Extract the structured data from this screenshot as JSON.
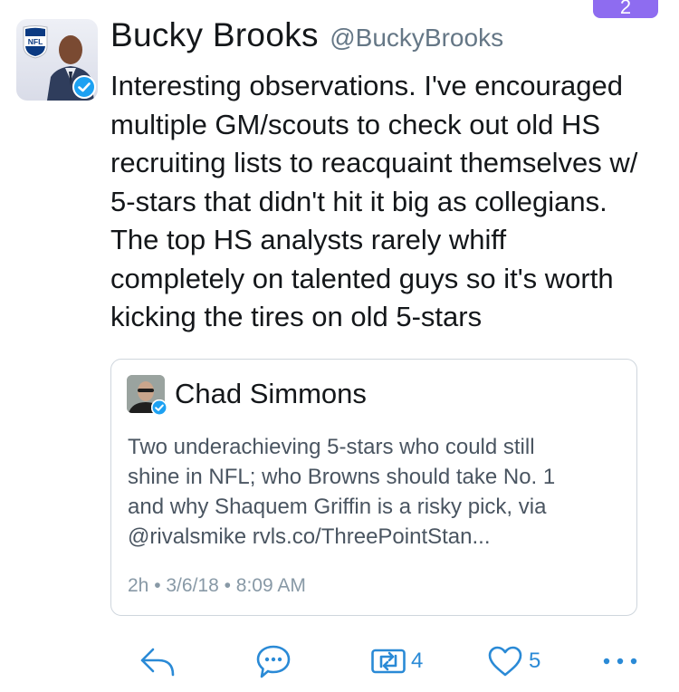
{
  "top_badge": "2",
  "tweet": {
    "author_name": "Bucky Brooks",
    "author_handle": "@BuckyBrooks",
    "text": "Interesting observations. I've encouraged\nmultiple GM/scouts to check out old HS\nrecruiting lists to reacquaint themselves w/\n5-stars that didn't hit it big as collegians.\nThe top HS analysts rarely whiff\ncompletely on talented guys so it's worth\nkicking the tires on old 5-stars",
    "avatar_logo_text": "NFL"
  },
  "quote": {
    "author_name": "Chad Simmons",
    "text": "Two underachieving 5-stars who could still\nshine in NFL; who Browns should take No. 1\nand why Shaquem Griffin is a risky pick, via\n@rivalsmike rvls.co/ThreePointStan...",
    "timestamp": "2h • 3/6/18 • 8:09 AM"
  },
  "actions": {
    "retweet_count": "4",
    "like_count": "5"
  },
  "colors": {
    "accent": "#2a8ad6",
    "verified": "#1da1f2",
    "text_primary": "#14171a",
    "text_secondary": "#657786",
    "badge": "#8e6cf0"
  },
  "icons": [
    "reply-icon",
    "message-bubble-icon",
    "retweet-icon",
    "heart-icon",
    "more-icon",
    "verified-icon",
    "nfl-shield-icon"
  ]
}
